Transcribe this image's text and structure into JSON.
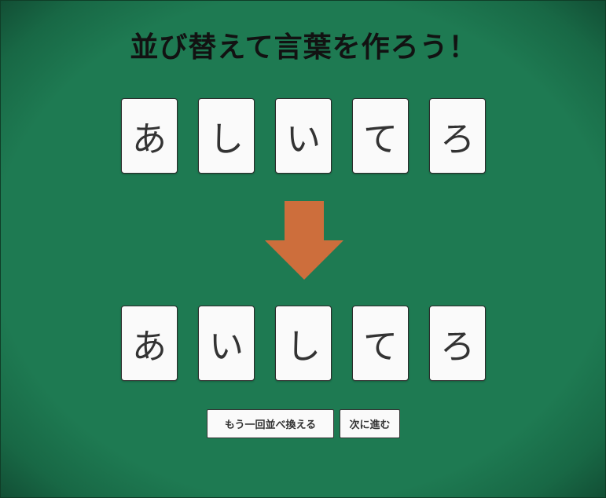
{
  "title": "並び替えて言葉を作ろう！",
  "scrambled_cards": [
    "あ",
    "し",
    "い",
    "て",
    "ろ"
  ],
  "answer_cards": [
    "あ",
    "い",
    "し",
    "て",
    "ろ"
  ],
  "arrow": {
    "icon": "down-arrow-icon",
    "color": "#cd6e3c"
  },
  "buttons": {
    "reshuffle_label": "もう一回並べ換える",
    "next_label": "次に進む"
  },
  "colors": {
    "board": "#1e7a52",
    "card": "#fafafa",
    "card_text": "#333333",
    "title": "#121212",
    "arrow": "#cd6e3c"
  }
}
